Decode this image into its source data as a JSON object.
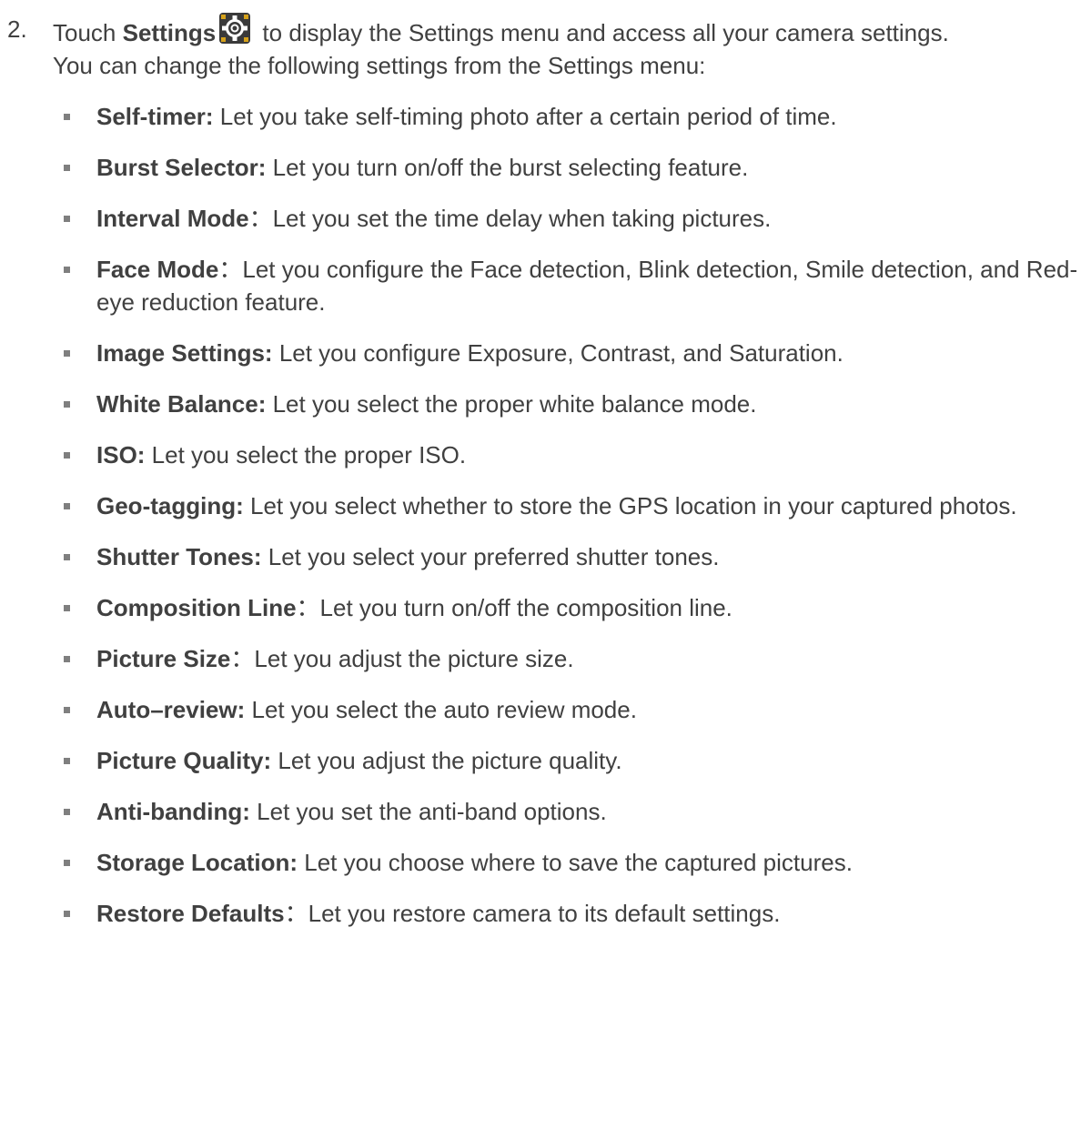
{
  "step": {
    "number": "2.",
    "prefix": "Touch ",
    "settings_label": "Settings",
    "line1_rest": " to display the Settings menu and access all your camera settings.",
    "line2": "You can change the following settings from the Settings menu:",
    "icon": "gear-icon"
  },
  "settings_items": [
    {
      "term": "Self-timer:",
      "desc": " Let you take self-timing photo after a certain period of time."
    },
    {
      "term": "Burst Selector:",
      "desc": " Let you turn on/off the burst selecting feature."
    },
    {
      "term": "Interval Mode",
      "desc": "：Let you set the time delay when taking pictures."
    },
    {
      "term": "Face Mode",
      "desc": "：Let you configure the Face detection, Blink detection, Smile detection, and Red-eye reduction feature."
    },
    {
      "term": "Image Settings:",
      "desc": " Let you configure Exposure, Contrast, and Saturation."
    },
    {
      "term": "White Balance:",
      "desc": " Let you select the proper white balance mode."
    },
    {
      "term": "ISO:",
      "desc": " Let you select the proper ISO."
    },
    {
      "term": "Geo-tagging:",
      "desc": " Let you select whether to store the GPS location in your captured photos."
    },
    {
      "term": "Shutter Tones:",
      "desc": " Let you select your preferred shutter tones."
    },
    {
      "term": "Composition Line",
      "desc": "：Let you turn on/off the composition line."
    },
    {
      "term": "Picture Size",
      "desc": "：Let you adjust the picture size."
    },
    {
      "term": "Auto–review:",
      "desc": " Let you select the auto review mode."
    },
    {
      "term": "Picture Quality:",
      "desc": " Let you adjust the picture quality."
    },
    {
      "term": "Anti-banding:",
      "desc": " Let you set the anti-band options."
    },
    {
      "term": "Storage Location:",
      "desc": " Let you choose where to save the captured pictures."
    },
    {
      "term": "Restore Defaults",
      "desc": "：Let you restore camera to its default settings."
    }
  ],
  "colors": {
    "text": "#404040",
    "bullet": "#7f7f7f",
    "icon_bg": "#3a3a3a",
    "icon_fg": "#ffffff",
    "icon_accent": "#d6a21a"
  }
}
